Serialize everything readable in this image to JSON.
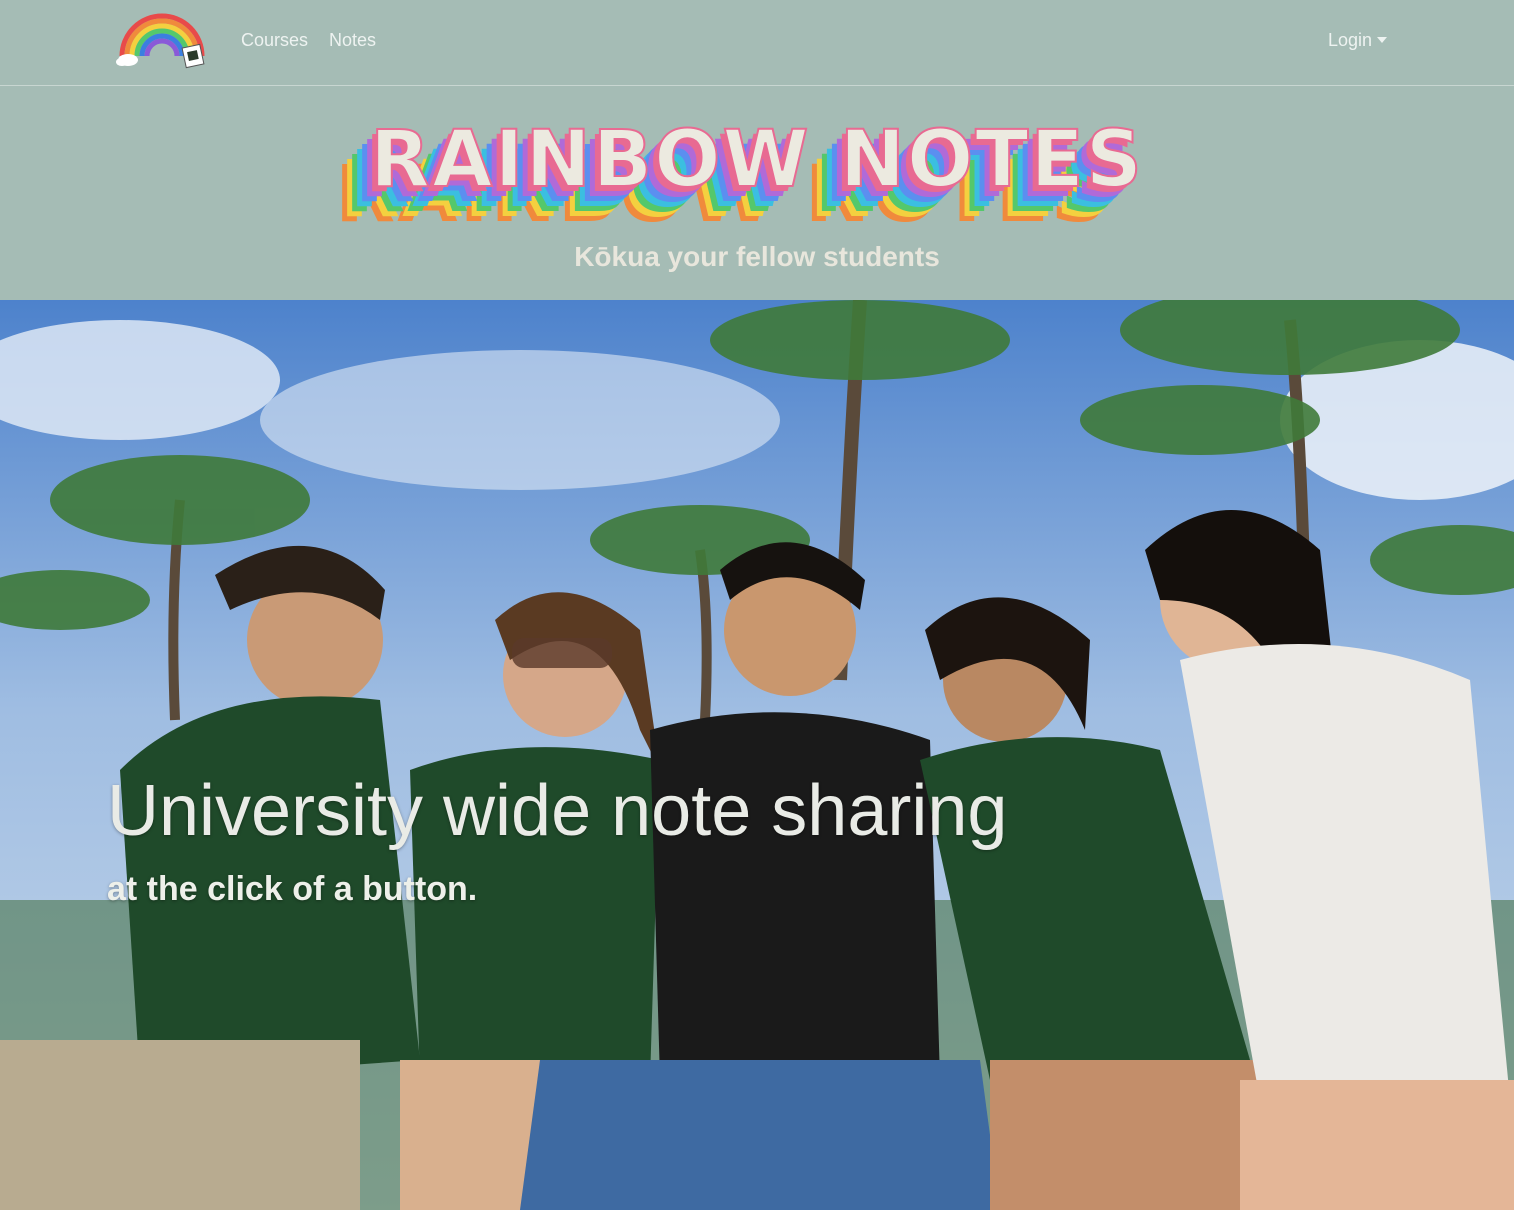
{
  "nav": {
    "logo_icon": "rainbow-logo-icon",
    "links": [
      {
        "label": "Courses"
      },
      {
        "label": "Notes"
      }
    ],
    "login_label": "Login",
    "login_icon": "caret-down-icon"
  },
  "brand": {
    "title": "RAINBOW NOTES",
    "tagline": "Kōkua your fellow students"
  },
  "hero": {
    "photo": "group-of-five-students-under-palm-trees",
    "heading": "University wide note sharing",
    "subheading": "at the click of a button."
  },
  "colors": {
    "background": "#a5bcb5",
    "nav_text": "#eef3f1",
    "title_fill": "#eceae0",
    "rainbow": [
      "#e86a92",
      "#b06ad8",
      "#5b8ff0",
      "#3bbfe0",
      "#54c86b",
      "#f4d03f",
      "#f08a3c"
    ]
  }
}
